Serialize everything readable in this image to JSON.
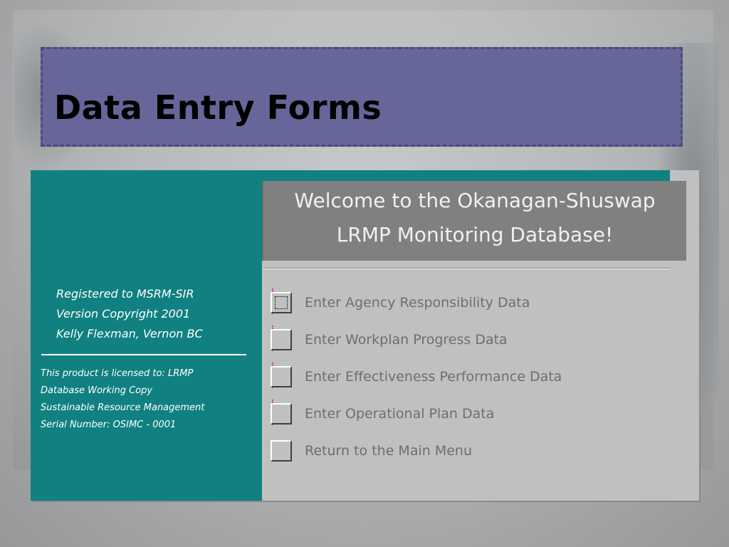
{
  "slide": {
    "title": "Data Entry Forms"
  },
  "left_panel": {
    "registration": [
      "Registered to MSRM-SIR",
      "Version Copyright 2001",
      "Kelly Flexman, Vernon BC"
    ],
    "license": [
      "This product is licensed to: LRMP",
      "Database Working Copy",
      "Sustainable Resource Management",
      "Serial Number: OSIMC - 0001"
    ]
  },
  "welcome": {
    "line1": "Welcome to the Okanagan-Shuswap",
    "line2": "LRMP Monitoring Database!"
  },
  "menu": {
    "items": [
      {
        "label": "Enter Agency Responsibility Data"
      },
      {
        "label": "Enter Workplan Progress Data"
      },
      {
        "label": "Enter Effectiveness Performance Data"
      },
      {
        "label": "Enter Operational Plan Data"
      },
      {
        "label": "Return to the Main Menu"
      }
    ]
  },
  "colors": {
    "title_box": "#66669a",
    "left_panel": "#118080",
    "welcome_box": "#808080",
    "form_background": "#c0c0c0"
  }
}
